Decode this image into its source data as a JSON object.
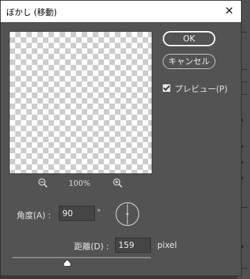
{
  "window": {
    "title": "ぼかし (移動)",
    "close_symbol": "✕"
  },
  "buttons": {
    "ok": "OK",
    "cancel": "キャンセル"
  },
  "preview_checkbox": {
    "label": "プレビュー(P)",
    "checked": true
  },
  "zoom": {
    "value": "100%",
    "zoom_out_icon": "zoom-out-icon",
    "zoom_in_icon": "zoom-in-icon"
  },
  "angle": {
    "label": "角度(A) :",
    "value": "90",
    "unit": "°"
  },
  "distance": {
    "label": "距離(D) :",
    "value": "159",
    "unit": "pixel",
    "slider_fraction": 0.4
  },
  "colors": {
    "dialog_bg": "#535353",
    "titlebar_bg": "#ffffff",
    "field_bg": "#454545"
  }
}
